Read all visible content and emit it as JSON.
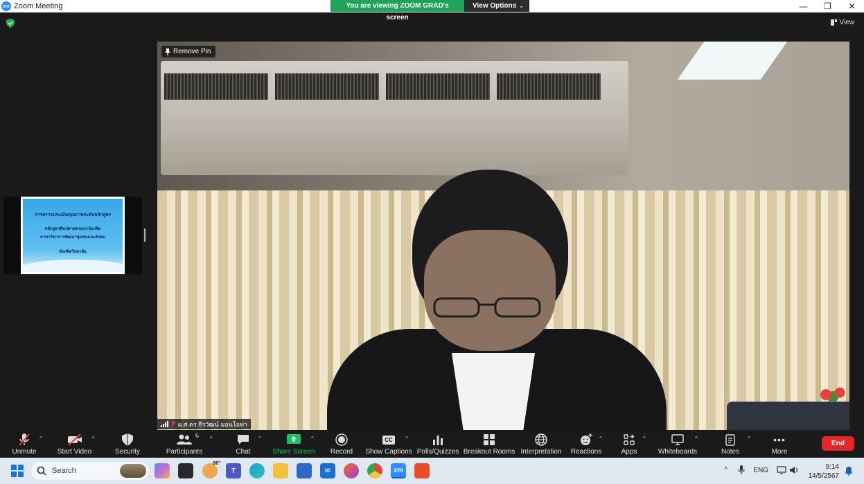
{
  "window": {
    "app_logo": "zm",
    "title": "Zoom Meeting",
    "controls": [
      "—",
      "❐",
      "✕"
    ]
  },
  "banner": {
    "message": "You are viewing ZOOM GRAD's screen",
    "options_label": "View Options"
  },
  "view_button": {
    "label": "View"
  },
  "pin": {
    "label": "Remove Pin"
  },
  "name_tag": {
    "name": "ผ.ศ.ดร.ธีรวัฒน์ มอนโอท่า"
  },
  "thumbnail": {
    "lines": [
      "การตรวจประเมินคุณภาพระดับหลักสูตร",
      "หลักสูตรศิลปศาสตรมหาบัณฑิต",
      "สาขาวิชาการพัฒนาชุมชนและสังคม",
      "บัณฑิตวิทยาลัย"
    ]
  },
  "toolbar": {
    "items": [
      {
        "label": "Unmute",
        "icon": "muted-mic-icon"
      },
      {
        "label": "Start Video",
        "icon": "video-off-icon"
      },
      {
        "label": "Security",
        "icon": "shield-icon"
      },
      {
        "label": "Participants",
        "icon": "participants-icon",
        "count": "6"
      },
      {
        "label": "Chat",
        "icon": "chat-icon"
      },
      {
        "label": "Share Screen",
        "icon": "share-screen-icon"
      },
      {
        "label": "Record",
        "icon": "record-icon"
      },
      {
        "label": "Show Captions",
        "icon": "captions-icon",
        "icon_text": "CC"
      },
      {
        "label": "Polls/Quizzes",
        "icon": "polls-icon"
      },
      {
        "label": "Breakout Rooms",
        "icon": "breakout-rooms-icon"
      },
      {
        "label": "Interpretation",
        "icon": "globe-icon"
      },
      {
        "label": "Reactions",
        "icon": "reactions-icon"
      },
      {
        "label": "Apps",
        "icon": "apps-icon"
      },
      {
        "label": "Whiteboards",
        "icon": "whiteboard-icon"
      },
      {
        "label": "Notes",
        "icon": "notes-icon"
      },
      {
        "label": "More",
        "icon": "more-icon",
        "icon_text": "•••"
      }
    ],
    "end_label": "End"
  },
  "taskbar": {
    "search_placeholder": "Search",
    "weather": "86°",
    "tray": {
      "language": "ENG",
      "time": "9:14",
      "date": "14/5/2567"
    }
  },
  "colors": {
    "share_green": "#19c55e",
    "banner_green": "#1fa35b",
    "end_red": "#e02828",
    "zoom_blue": "#2d8cff"
  }
}
